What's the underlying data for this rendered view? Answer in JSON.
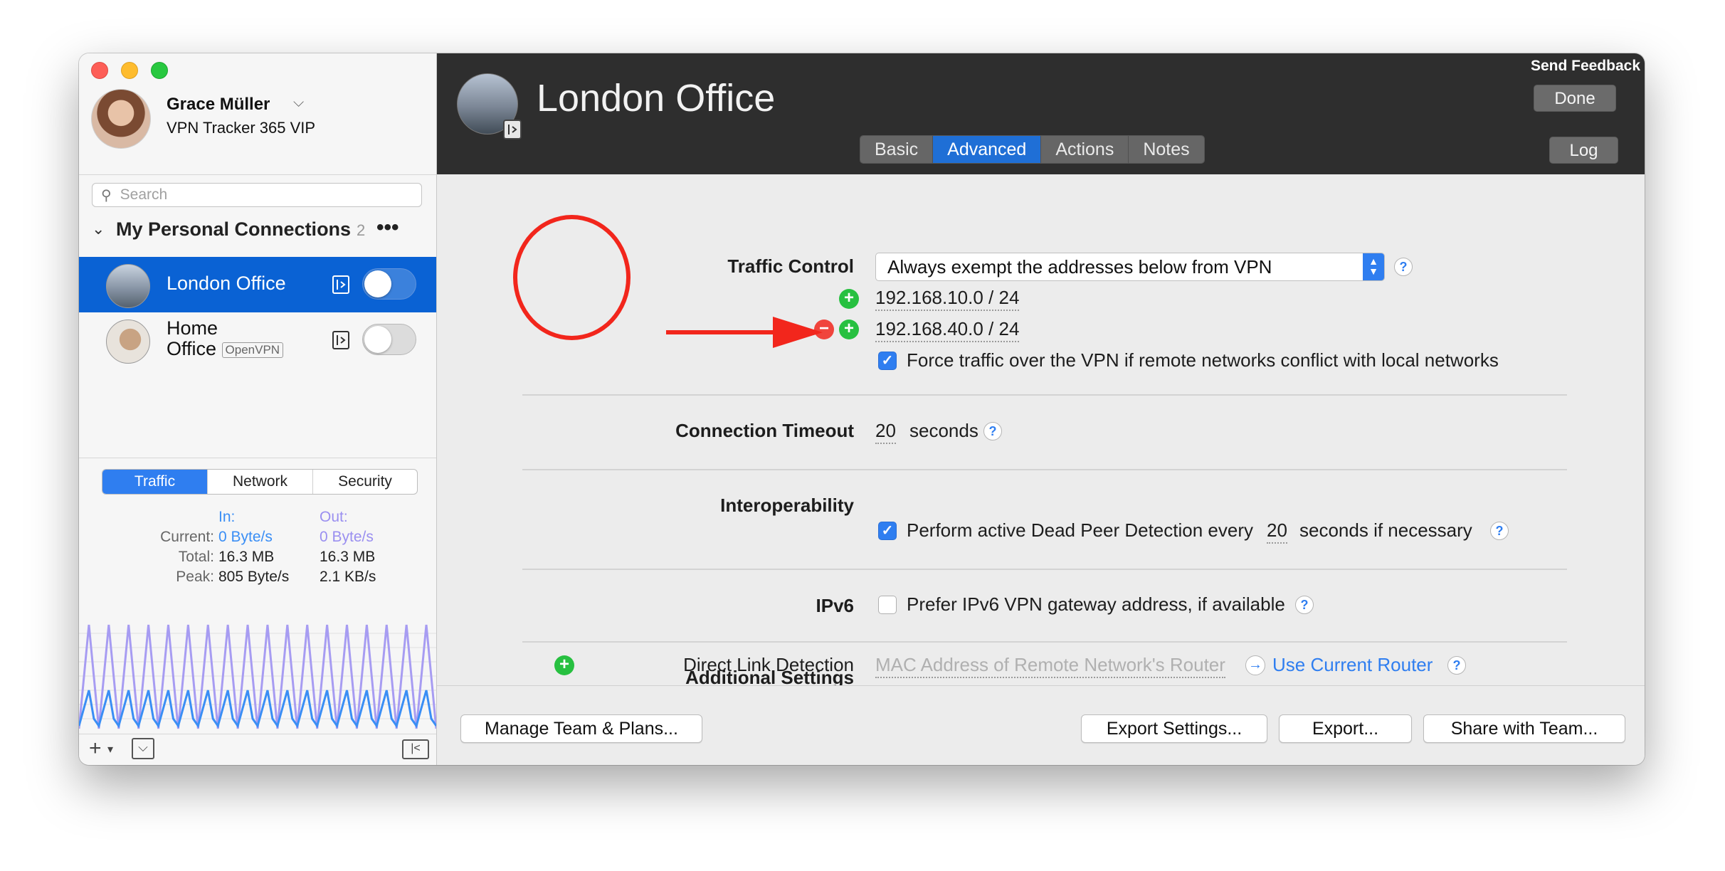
{
  "sidebar": {
    "user_name": "Grace Müller",
    "user_plan": "VPN Tracker 365 VIP",
    "search_placeholder": "Search",
    "group_title": "My Personal Connections",
    "group_count": "2",
    "group_more": "•••",
    "connections": [
      {
        "name": "London Office",
        "selected": true
      },
      {
        "name_line1": "Home",
        "name_line2": "Office",
        "tag": "OpenVPN",
        "selected": false
      }
    ],
    "stat_tabs": [
      "Traffic",
      "Network",
      "Security"
    ],
    "stats": {
      "in_label": "In:",
      "out_label": "Out:",
      "current_label": "Current:",
      "total_label": "Total:",
      "peak_label": "Peak:",
      "current_in": "0 Byte/s",
      "current_out": "0 Byte/s",
      "total_in": "16.3 MB",
      "total_out": "16.3 MB",
      "peak_in": "805 Byte/s",
      "peak_out": "2.1 KB/s"
    },
    "add_glyph": "+",
    "add_chevron": "▾",
    "filter_glyph": "⌵",
    "collapse_glyph": "|<"
  },
  "header": {
    "title": "London Office",
    "send_feedback": "Send Feedback",
    "done_label": "Done",
    "log_label": "Log",
    "tabs": [
      "Basic",
      "Advanced",
      "Actions",
      "Notes"
    ],
    "active_tab": "Advanced"
  },
  "settings": {
    "traffic_control_label": "Traffic Control",
    "traffic_control_value": "Always exempt the addresses below from VPN",
    "addresses": [
      "192.168.10.0 / 24",
      "192.168.40.0 / 24"
    ],
    "force_traffic_label": "Force traffic over the VPN if remote networks conflict with local networks",
    "connection_timeout_label": "Connection Timeout",
    "timeout_value": "20",
    "timeout_unit": "seconds",
    "interop_label": "Interoperability",
    "dpd_prefix": "Perform active Dead Peer Detection every",
    "dpd_value": "20",
    "dpd_suffix": "seconds if necessary",
    "ipv6_label": "IPv6",
    "ipv6_option": "Prefer IPv6 VPN gateway address, if available",
    "additional_label": "Additional Settings",
    "direct_link_label": "Direct Link Detection",
    "mac_placeholder": "MAC Address of Remote Network's Router",
    "use_router_label": "Use Current Router",
    "help_glyph": "?"
  },
  "footer": {
    "manage_label": "Manage Team & Plans...",
    "export_settings_label": "Export Settings...",
    "export_label": "Export...",
    "share_label": "Share with Team..."
  },
  "colors": {
    "accent": "#2f7ef0",
    "selection": "#0a62d4",
    "annotation": "#f2261c",
    "add_green": "#27c040",
    "remove_red": "#f0443c"
  },
  "traffic_graph": {
    "in_color": "#3a8ef5",
    "out_color": "#a79cf2",
    "peaks": 18
  }
}
